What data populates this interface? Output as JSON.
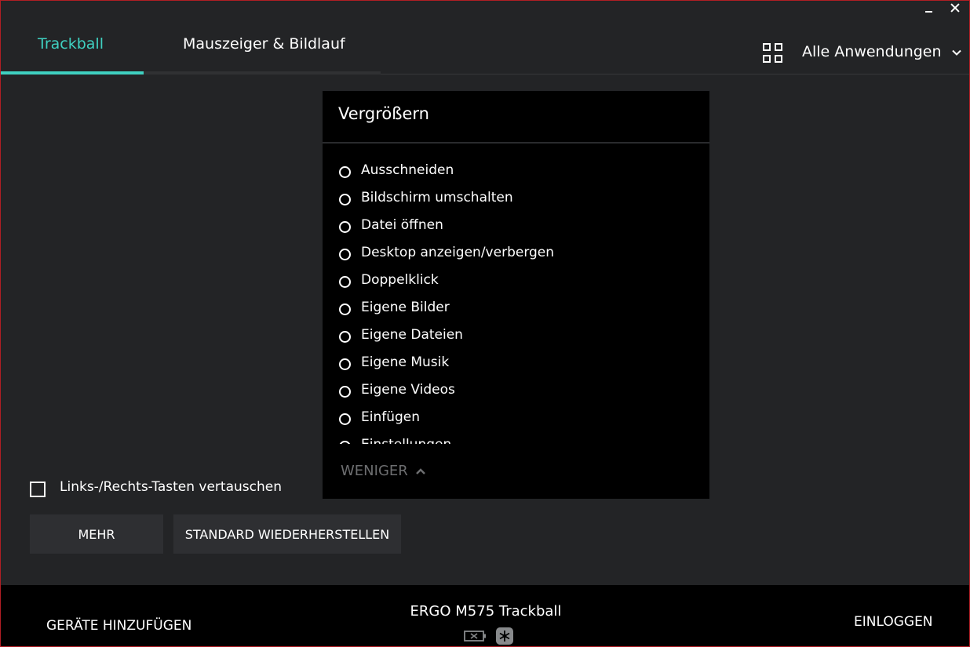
{
  "window": {
    "minimize_icon": "minimize-icon",
    "close_icon": "close-icon",
    "border_color": "#b01e24"
  },
  "tabs": [
    {
      "label": "Trackball",
      "active": true
    },
    {
      "label": "Mauszeiger & Bildlauf",
      "active": false
    }
  ],
  "accent_color": "#3fd1c1",
  "app_selector": {
    "icon": "grid-icon",
    "label": "Alle Anwendungen",
    "chevron": "chevron-down-icon"
  },
  "dropdown": {
    "title": "Vergrößern",
    "options": [
      "Ausschneiden",
      "Bildschirm umschalten",
      "Datei öffnen",
      "Desktop anzeigen/verbergen",
      "Doppelklick",
      "Eigene Bilder",
      "Eigene Dateien",
      "Eigene Musik",
      "Eigene Videos",
      "Einfügen",
      "Einstellungen"
    ],
    "less_label": "WENIGER",
    "less_icon": "chevron-up-icon"
  },
  "swap_buttons": {
    "label": "Links-/Rechts-Tasten vertauschen",
    "checked": false
  },
  "buttons": {
    "more": "MEHR",
    "restore_default": "STANDARD WIEDERHERSTELLEN"
  },
  "footer": {
    "add_devices": "GERÄTE HINZUFÜGEN",
    "device_name": "ERGO M575 Trackball",
    "battery_icon": "battery-unknown-icon",
    "receiver_icon": "unifying-receiver-icon",
    "login": "EINLOGGEN"
  }
}
